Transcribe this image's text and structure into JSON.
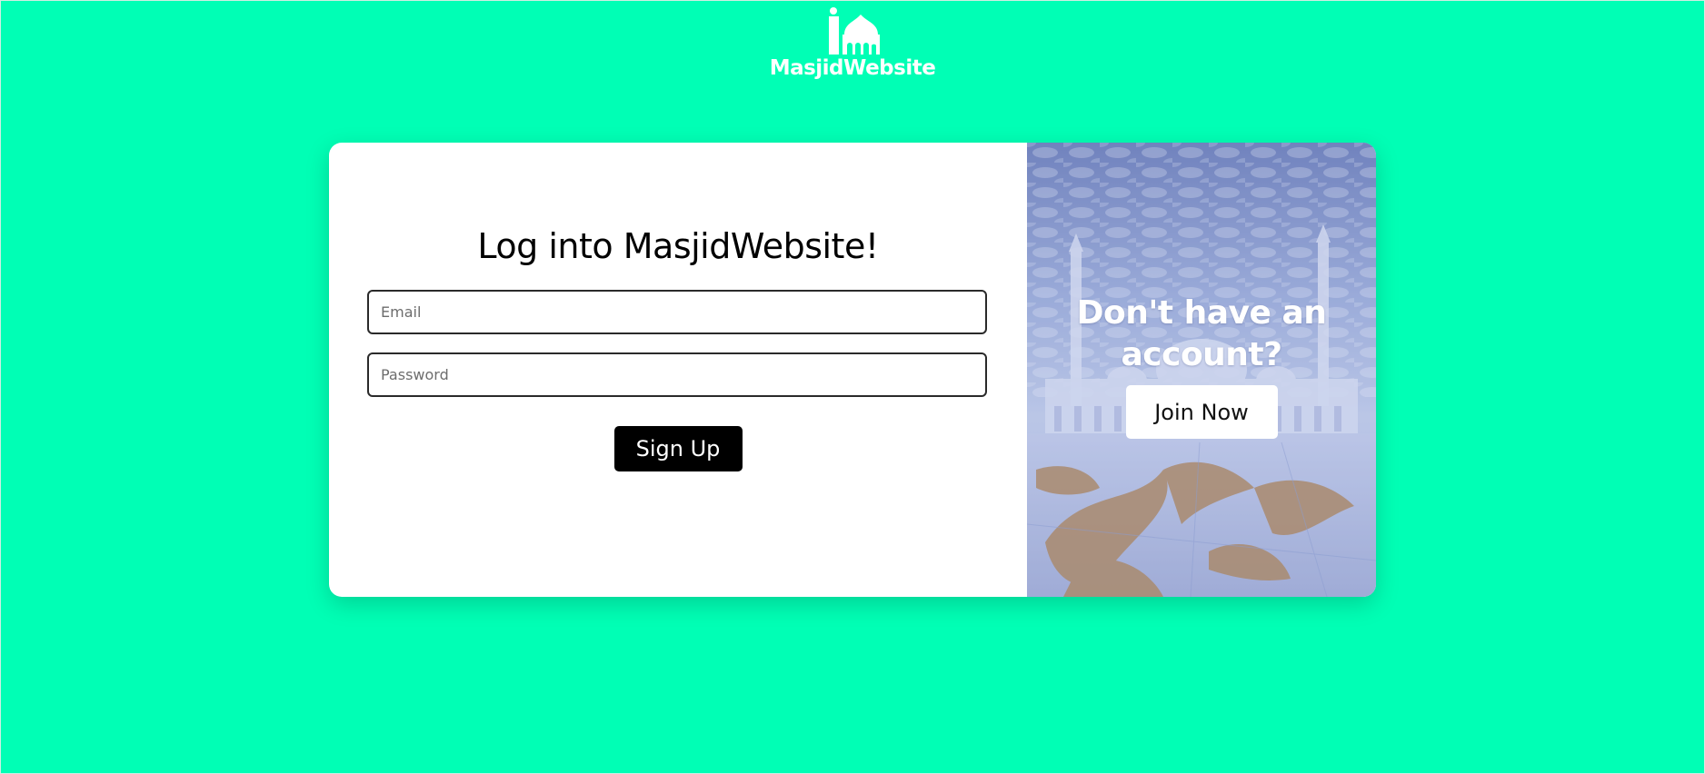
{
  "brand": {
    "name": "MasjidWebsite",
    "icon": "mosque-logo-icon",
    "background_color": "#00ffb5"
  },
  "login": {
    "title": "Log into MasjidWebsite!",
    "email_placeholder": "Email",
    "password_placeholder": "Password",
    "submit_label": "Sign Up",
    "submit_color": "#000000"
  },
  "promo": {
    "title": "Don't have an account?",
    "cta_label": "Join Now",
    "background_image": "mosque-courtyard-photo"
  }
}
